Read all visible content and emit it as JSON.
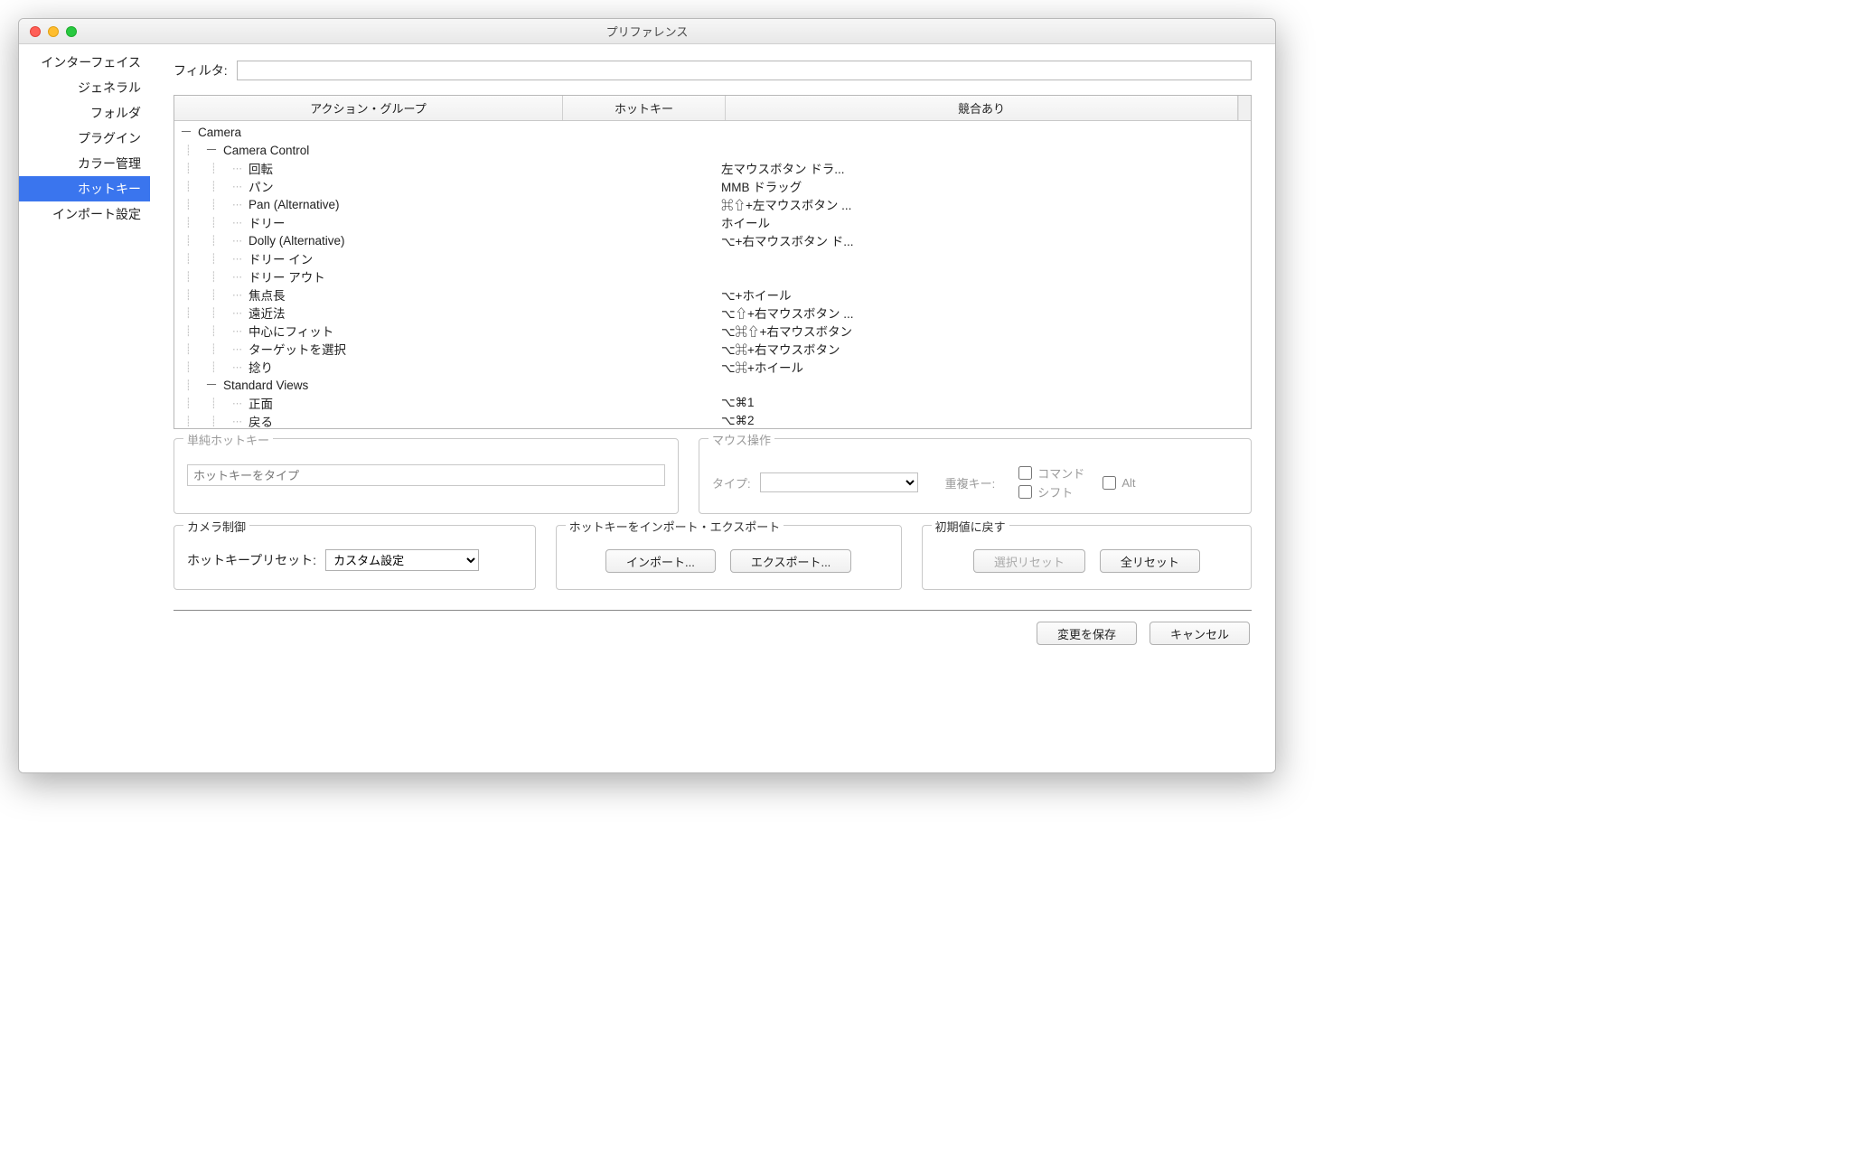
{
  "window": {
    "title": "プリファレンス"
  },
  "sidebar": {
    "items": [
      {
        "label": "インターフェイス"
      },
      {
        "label": "ジェネラル"
      },
      {
        "label": "フォルダ"
      },
      {
        "label": "プラグイン"
      },
      {
        "label": "カラー管理"
      },
      {
        "label": "ホットキー"
      },
      {
        "label": "インポート設定"
      }
    ],
    "selected_index": 5
  },
  "filter": {
    "label": "フィルタ:",
    "value": ""
  },
  "columns": {
    "action": "アクション・グループ",
    "hotkey": "ホットキー",
    "conflict": "競合あり"
  },
  "tree": [
    {
      "depth": 0,
      "toggle": "－",
      "label": "Camera",
      "hotkey": ""
    },
    {
      "depth": 1,
      "toggle": "－",
      "label": "Camera Control",
      "hotkey": ""
    },
    {
      "depth": 2,
      "toggle": "",
      "label": "回転",
      "hotkey": "左マウスボタン ドラ..."
    },
    {
      "depth": 2,
      "toggle": "",
      "label": "パン",
      "hotkey": "MMB ドラッグ"
    },
    {
      "depth": 2,
      "toggle": "",
      "label": "Pan (Alternative)",
      "hotkey": "⌘⇧+左マウスボタン ..."
    },
    {
      "depth": 2,
      "toggle": "",
      "label": "ドリー",
      "hotkey": "ホイール"
    },
    {
      "depth": 2,
      "toggle": "",
      "label": "Dolly (Alternative)",
      "hotkey": "⌥+右マウスボタン ド..."
    },
    {
      "depth": 2,
      "toggle": "",
      "label": "ドリー イン",
      "hotkey": ""
    },
    {
      "depth": 2,
      "toggle": "",
      "label": "ドリー アウト",
      "hotkey": ""
    },
    {
      "depth": 2,
      "toggle": "",
      "label": "焦点長",
      "hotkey": "⌥+ホイール"
    },
    {
      "depth": 2,
      "toggle": "",
      "label": "遠近法",
      "hotkey": "⌥⇧+右マウスボタン ..."
    },
    {
      "depth": 2,
      "toggle": "",
      "label": "中心にフィット",
      "hotkey": "⌥⌘⇧+右マウスボタン"
    },
    {
      "depth": 2,
      "toggle": "",
      "label": "ターゲットを選択",
      "hotkey": "⌥⌘+右マウスボタン"
    },
    {
      "depth": 2,
      "toggle": "",
      "label": "捻り",
      "hotkey": "⌥⌘+ホイール"
    },
    {
      "depth": 1,
      "toggle": "－",
      "label": "Standard Views",
      "hotkey": ""
    },
    {
      "depth": 2,
      "toggle": "",
      "label": "正面",
      "hotkey": "⌥⌘1"
    },
    {
      "depth": 2,
      "toggle": "",
      "label": "戻る",
      "hotkey": "⌥⌘2"
    }
  ],
  "simple_hotkey": {
    "legend": "単純ホットキー",
    "placeholder": "ホットキーをタイプ"
  },
  "mouse": {
    "legend": "マウス操作",
    "type_label": "タイプ:",
    "type_value": "",
    "dup_label": "重複キー:",
    "check_command": "コマンド",
    "check_shift": "シフト",
    "check_alt": "Alt"
  },
  "camera_ctrl": {
    "legend": "カメラ制御",
    "preset_label": "ホットキープリセット:",
    "preset_value": "カスタム設定"
  },
  "import_export": {
    "legend": "ホットキーをインポート・エクスポート",
    "import_btn": "インポート...",
    "export_btn": "エクスポート..."
  },
  "reset": {
    "legend": "初期値に戻す",
    "sel_reset": "選択リセット",
    "all_reset": "全リセット"
  },
  "footer": {
    "save": "変更を保存",
    "cancel": "キャンセル"
  }
}
